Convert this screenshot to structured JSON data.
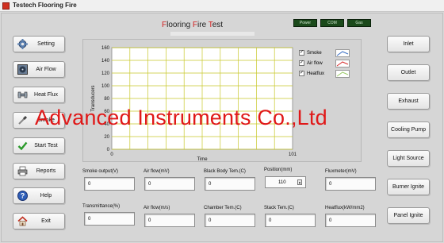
{
  "window": {
    "title": "Testech Flooring Fire"
  },
  "form": {
    "title_part1": "F",
    "title_part2": "looring ",
    "title_part3": "F",
    "title_part4": "ire ",
    "title_part5": "T",
    "title_part6": "est"
  },
  "leds": [
    {
      "label": "Power"
    },
    {
      "label": "COM"
    },
    {
      "label": "Gas"
    }
  ],
  "left_buttons": [
    {
      "label": "Setting",
      "icon": "gear-icon"
    },
    {
      "label": "Air Flow",
      "icon": "fan-icon"
    },
    {
      "label": "Heat Flux",
      "icon": "wrench-icon"
    },
    {
      "label": "Smoke",
      "icon": "screwdriver-icon"
    },
    {
      "label": "Start Test",
      "icon": "checkmark-icon"
    },
    {
      "label": "Reports",
      "icon": "printer-icon"
    },
    {
      "label": "Help",
      "icon": "help-icon"
    },
    {
      "label": "Exit",
      "icon": "home-icon"
    }
  ],
  "right_buttons": [
    {
      "label": "Inlet"
    },
    {
      "label": "Outlet"
    },
    {
      "label": "Exhaust"
    },
    {
      "label": "Cooling Pump"
    },
    {
      "label": "Light Source"
    },
    {
      "label": "Burner Ignite"
    },
    {
      "label": "Panel Ignite"
    }
  ],
  "chart_data": {
    "type": "line",
    "xlabel": "Time",
    "ylabel": "Transducers",
    "xlim": [
      0,
      101
    ],
    "ylim": [
      0,
      160
    ],
    "x_ticks": [
      "0",
      "101"
    ],
    "y_ticks": [
      "0",
      "20",
      "40",
      "60",
      "80",
      "100",
      "120",
      "140",
      "160"
    ],
    "grid": true,
    "legend_placement": "right",
    "series": [
      {
        "name": "Smoke",
        "color": "#3a6fc4",
        "values": []
      },
      {
        "name": "Air flow",
        "color": "#d83030",
        "values": []
      },
      {
        "name": "Heatflux",
        "color": "#9ccc6a",
        "values": []
      }
    ],
    "grid_color": "#c8c82a",
    "plot_bg": "#ffffff"
  },
  "fields_row1": [
    {
      "label": "Smoke output(V)",
      "value": "0"
    },
    {
      "label": "Air flow(mV)",
      "value": "0"
    },
    {
      "label": "Black Body Tem.(C)",
      "value": "0"
    },
    {
      "label": "Position(mm)",
      "value": "110"
    },
    {
      "label": "Fluxmeter(mV)",
      "value": "0"
    }
  ],
  "fields_row2": [
    {
      "label": "Transmittance(%)",
      "value": "0"
    },
    {
      "label": "Air flow(m/s)",
      "value": "0"
    },
    {
      "label": "Chamber Tem.(C)",
      "value": "0"
    },
    {
      "label": "Stack Tem.(C)",
      "value": "0"
    },
    {
      "label": "Heatflux(kW/mm2)",
      "value": "0"
    }
  ],
  "watermark": "Advanced Instruments Co.,Ltd"
}
